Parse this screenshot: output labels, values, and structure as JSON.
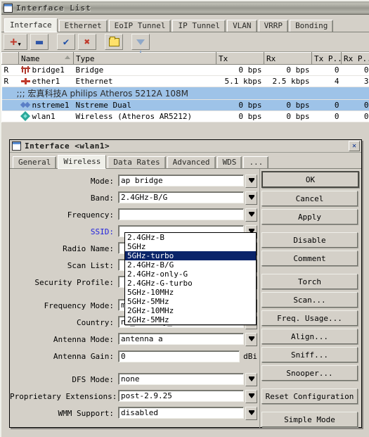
{
  "main_window": {
    "title": "Interface List",
    "tabs": [
      {
        "label": "Interface",
        "active": true
      },
      {
        "label": "Ethernet",
        "active": false
      },
      {
        "label": "EoIP Tunnel",
        "active": false
      },
      {
        "label": "IP Tunnel",
        "active": false
      },
      {
        "label": "VLAN",
        "active": false
      },
      {
        "label": "VRRP",
        "active": false
      },
      {
        "label": "Bonding",
        "active": false
      }
    ],
    "toolbar": [
      {
        "name": "add-button",
        "icon": "plus-icon",
        "label": "+"
      },
      {
        "name": "remove-button",
        "icon": "minus-icon",
        "label": "-"
      },
      {
        "name": "enable-button",
        "icon": "check-icon",
        "label": "✔"
      },
      {
        "name": "disable-button",
        "icon": "cross-icon",
        "label": "✖"
      },
      {
        "name": "comment-button",
        "icon": "folder-icon",
        "label": ""
      },
      {
        "name": "filter-button",
        "icon": "funnel-icon",
        "label": ""
      }
    ],
    "table": {
      "columns": [
        "",
        "Name",
        "Type",
        "Tx",
        "Rx",
        "Tx P...",
        "Rx P..."
      ],
      "sorted_column": "Name",
      "rows": [
        {
          "flag": "R",
          "icon": "bridge-icon",
          "name": "bridge1",
          "type": "Bridge",
          "tx": "0 bps",
          "rx": "0 bps",
          "txp": "0",
          "rxp": "0",
          "selected": false,
          "kind": "row"
        },
        {
          "flag": "R",
          "icon": "ethernet-icon",
          "name": "ether1",
          "type": "Ethernet",
          "tx": "5.1 kbps",
          "rx": "2.5 kbps",
          "txp": "4",
          "rxp": "3",
          "selected": false,
          "kind": "row"
        },
        {
          "kind": "comment",
          "text": ";;; 宏真科技A philips Atheros 5212A 108M",
          "selected": true
        },
        {
          "flag": "",
          "icon": "nstreme-icon",
          "name": "nstreme1",
          "type": "Nstreme Dual",
          "tx": "0 bps",
          "rx": "0 bps",
          "txp": "0",
          "rxp": "0",
          "selected": true,
          "kind": "row"
        },
        {
          "flag": "",
          "icon": "wireless-icon",
          "name": "wlan1",
          "type": "Wireless (Atheros AR5212)",
          "tx": "0 bps",
          "rx": "0 bps",
          "txp": "0",
          "rxp": "0",
          "selected": false,
          "kind": "row"
        }
      ]
    }
  },
  "dialog": {
    "title": "Interface <wlan1>",
    "close_label": "✕",
    "tabs": [
      {
        "label": "General",
        "active": false
      },
      {
        "label": "Wireless",
        "active": true
      },
      {
        "label": "Data Rates",
        "active": false
      },
      {
        "label": "Advanced",
        "active": false
      },
      {
        "label": "WDS",
        "active": false
      },
      {
        "label": "...",
        "active": false
      }
    ],
    "fields": {
      "mode": {
        "label": "Mode:",
        "value": "ap bridge"
      },
      "band": {
        "label": "Band:",
        "value": "2.4GHz-B/G"
      },
      "frequency": {
        "label": "Frequency:",
        "value": ""
      },
      "ssid": {
        "label": "SSID:",
        "value": ""
      },
      "radio_name": {
        "label": "Radio Name:",
        "value": ""
      },
      "scan_list": {
        "label": "Scan List:",
        "value": ""
      },
      "security_profile": {
        "label": "Security Profile:",
        "value": ""
      },
      "frequency_mode": {
        "label": "Frequency Mode:",
        "value": "manual txpower"
      },
      "country": {
        "label": "Country:",
        "value": "no_country_set"
      },
      "antenna_mode": {
        "label": "Antenna Mode:",
        "value": "antenna a"
      },
      "antenna_gain": {
        "label": "Antenna Gain:",
        "value": "0",
        "unit": "dBi"
      },
      "dfs_mode": {
        "label": "DFS Mode:",
        "value": "none"
      },
      "proprietary_extensions": {
        "label": "Proprietary Extensions:",
        "value": "post-2.9.25"
      },
      "wmm_support": {
        "label": "WMM Support:",
        "value": "disabled"
      }
    },
    "band_dropdown": {
      "open": true,
      "highlighted": "5GHz-turbo",
      "options": [
        "2.4GHz-B",
        "5GHz",
        "5GHz-turbo",
        "2.4GHz-B/G",
        "2.4GHz-only-G",
        "2.4GHz-G-turbo",
        "5GHz-10MHz",
        "5GHz-5MHz",
        "2GHz-10MHz",
        "2GHz-5MHz"
      ]
    },
    "buttons": [
      {
        "label": "OK",
        "name": "ok-button",
        "default": true
      },
      {
        "label": "Cancel",
        "name": "cancel-button",
        "default": false
      },
      {
        "label": "Apply",
        "name": "apply-button",
        "default": false
      },
      {
        "label": "Disable",
        "name": "disable-button",
        "default": false
      },
      {
        "label": "Comment",
        "name": "comment-button",
        "default": false
      },
      {
        "label": "Torch",
        "name": "torch-button",
        "default": false
      },
      {
        "label": "Scan...",
        "name": "scan-button",
        "default": false
      },
      {
        "label": "Freq. Usage...",
        "name": "freq-usage-button",
        "default": false
      },
      {
        "label": "Align...",
        "name": "align-button",
        "default": false
      },
      {
        "label": "Sniff...",
        "name": "sniff-button",
        "default": false
      },
      {
        "label": "Snooper...",
        "name": "snooper-button",
        "default": false
      },
      {
        "label": "Reset Configuration",
        "name": "reset-configuration-button",
        "default": false
      },
      {
        "label": "Simple Mode",
        "name": "simple-mode-button",
        "default": false
      }
    ]
  },
  "colors": {
    "window_face": "#d4d0c8",
    "selection": "#9ec3e8",
    "dropdown_highlight": "#0a246a",
    "link": "#2222dd"
  }
}
